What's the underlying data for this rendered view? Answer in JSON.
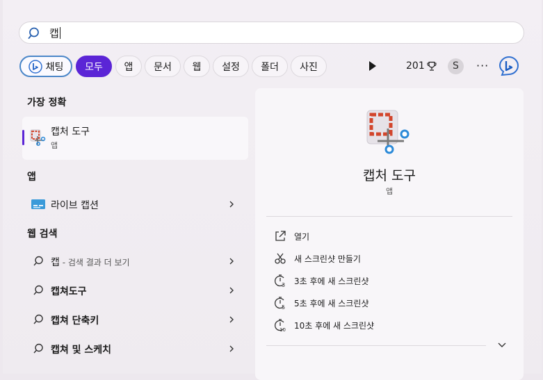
{
  "search": {
    "value": "캡"
  },
  "filters": {
    "chat": "채팅",
    "all": "모두",
    "apps": "앱",
    "documents": "문서",
    "web": "웹",
    "settings": "설정",
    "folders": "폴더",
    "photos": "사진",
    "points": "201",
    "avatar_initial": "S",
    "more": "···"
  },
  "left": {
    "best_match_header": "가장 정확",
    "best_match": {
      "title": "캡처 도구",
      "subtitle": "앱"
    },
    "apps_header": "앱",
    "apps": [
      {
        "label": "라이브 캡션"
      }
    ],
    "web_header": "웹 검색",
    "web_results": [
      {
        "label": "캡",
        "muted": " - 검색 결과 더 보기"
      },
      {
        "label": "캡쳐도구"
      },
      {
        "label": "캡쳐 단축키"
      },
      {
        "label": "캡쳐 및 스케치"
      }
    ]
  },
  "preview": {
    "title": "캡처 도구",
    "subtitle": "앱",
    "actions": [
      {
        "label": "열기",
        "icon": "open-external-icon"
      },
      {
        "label": "새 스크린샷 만들기",
        "icon": "snip-icon"
      },
      {
        "label": "3초 후에 새 스크린샷",
        "icon": "timer-3-icon"
      },
      {
        "label": "5초 후에 새 스크린샷",
        "icon": "timer-5-icon"
      },
      {
        "label": "10초 후에 새 스크린샷",
        "icon": "timer-10-icon"
      }
    ]
  },
  "colors": {
    "accent": "#5b25d6",
    "chat_border": "#4a86c8"
  }
}
